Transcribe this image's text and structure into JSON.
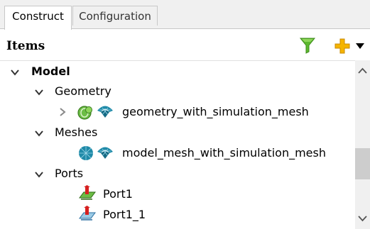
{
  "tabs": [
    {
      "label": "Construct",
      "active": true
    },
    {
      "label": "Configuration",
      "active": false
    }
  ],
  "header": {
    "title": "Items",
    "filter_icon": "filter-funnel-icon",
    "add_icon": "plus-icon"
  },
  "tree": {
    "model": "Model",
    "geometry": "Geometry",
    "geometry_item": "geometry_with_simulation_mesh",
    "meshes": "Meshes",
    "mesh_item": "model_mesh_with_simulation_mesh",
    "ports": "Ports",
    "port1": "Port1",
    "port1_1": "Port1_1"
  },
  "colors": {
    "filter_green": "#5cb82e",
    "plus_orange": "#f5b400",
    "geometry_green": "#6cbd45",
    "mesh_teal": "#1f8aa8",
    "port_red": "#d62020"
  }
}
